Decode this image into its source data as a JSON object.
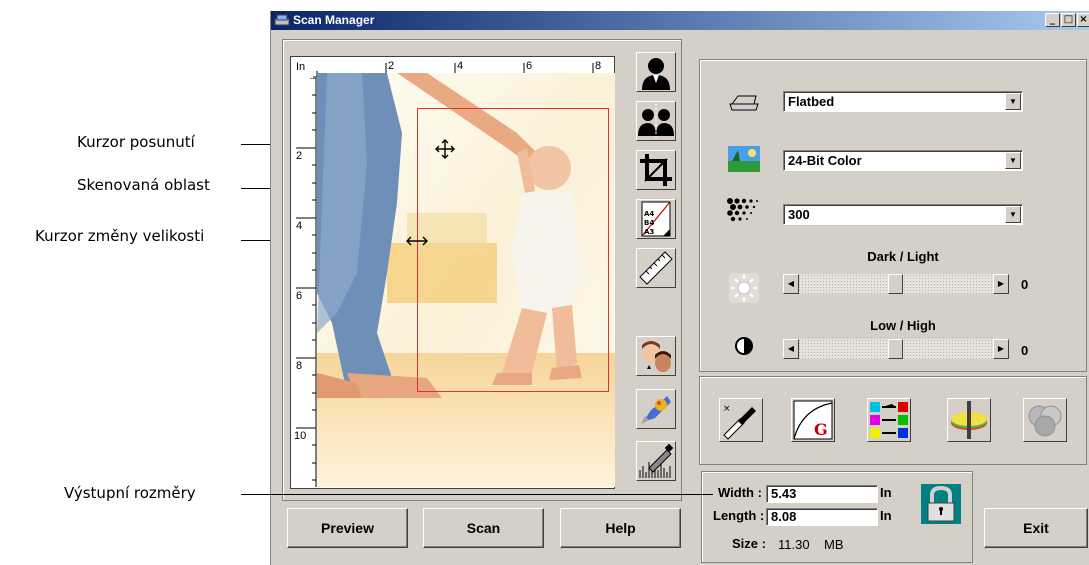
{
  "callouts": {
    "move_cursor": "Kurzor posunutí",
    "scan_area": "Skenovaná oblast",
    "resize_cursor": "Kurzor změny velikosti",
    "output_dimensions": "Výstupní rozměry"
  },
  "window": {
    "title": "Scan Manager",
    "minimize_label": "_",
    "maximize_label": "□",
    "close_label": "×"
  },
  "ruler": {
    "unit": "In",
    "h_ticks": [
      "2",
      "4",
      "6",
      "8"
    ],
    "v_ticks": [
      "2",
      "4",
      "6",
      "8",
      "10"
    ]
  },
  "buttons": {
    "preview": "Preview",
    "scan": "Scan",
    "help": "Help",
    "exit": "Exit"
  },
  "settings": {
    "source": "Flatbed",
    "mode": "24-Bit Color",
    "resolution": "300"
  },
  "adjustments": {
    "brightness_label": "Dark / Light",
    "brightness_value": "0",
    "contrast_label": "Low / High",
    "contrast_value": "0"
  },
  "output": {
    "width_label": "Width :",
    "width_value": "5.43",
    "width_unit": "In",
    "length_label": "Length :",
    "length_value": "8.08",
    "length_unit": "In",
    "size_label": "Size :",
    "size_value": "11.30",
    "size_unit": "MB"
  },
  "icons": {
    "tools": [
      "portrait-icon",
      "mirror-icon",
      "crop-icon",
      "paper-size-icon",
      "ruler-icon",
      "skin-tone-icon",
      "descreen-icon",
      "histogram-eyedropper-icon"
    ],
    "color_tools": [
      "white-black-point-icon",
      "gamma-curve-icon",
      "color-balance-icon",
      "hue-saturation-icon",
      "color-filter-icon"
    ],
    "lock": "lock-icon"
  }
}
